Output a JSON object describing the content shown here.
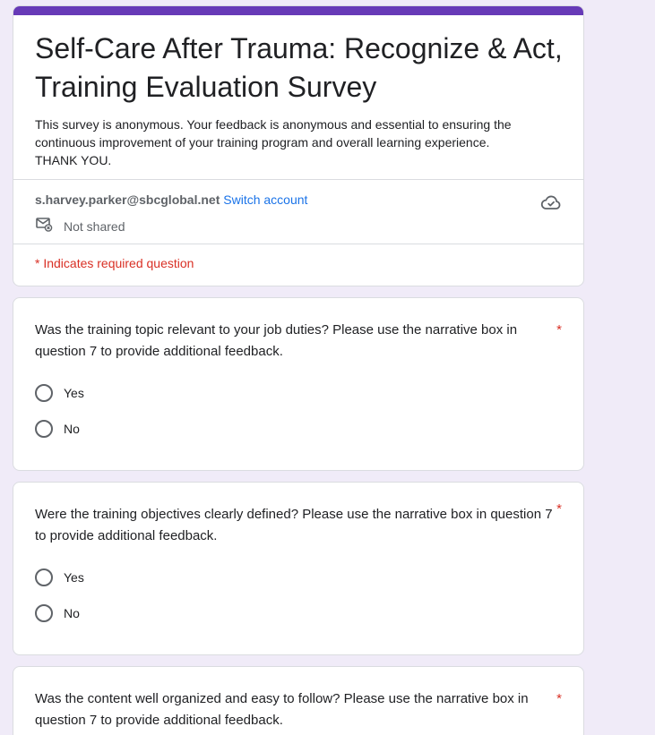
{
  "header": {
    "title": "Self-Care After Trauma:  Recognize & Act, Training Evaluation Survey",
    "description_lines": [
      "This survey is anonymous.   Your feedback is anonymous and essential to ensuring the",
      "continuous improvement of your training program and overall learning experience.",
      "THANK YOU."
    ],
    "account_email": "s.harvey.parker@sbcglobal.net",
    "switch_account_label": "Switch account",
    "share_status": "Not shared",
    "required_note": "* Indicates required question",
    "accent_color": "#673ab7",
    "icons": [
      "cloud-save-icon",
      "mail-not-shared-icon"
    ]
  },
  "questions": [
    {
      "text": "Was the training topic relevant to your job duties?  Please use the narrative box in question 7 to provide additional feedback.",
      "required_mark": "*",
      "options": [
        "Yes",
        "No"
      ]
    },
    {
      "text": "Were the training objectives clearly defined?  Please use the narrative box in question 7 to provide additional feedback.",
      "required_mark": "*",
      "options": [
        "Yes",
        "No"
      ]
    },
    {
      "text": "Was the content well organized and easy to follow?  Please use the narrative box in question 7 to provide additional feedback.",
      "required_mark": "*",
      "options": []
    }
  ]
}
